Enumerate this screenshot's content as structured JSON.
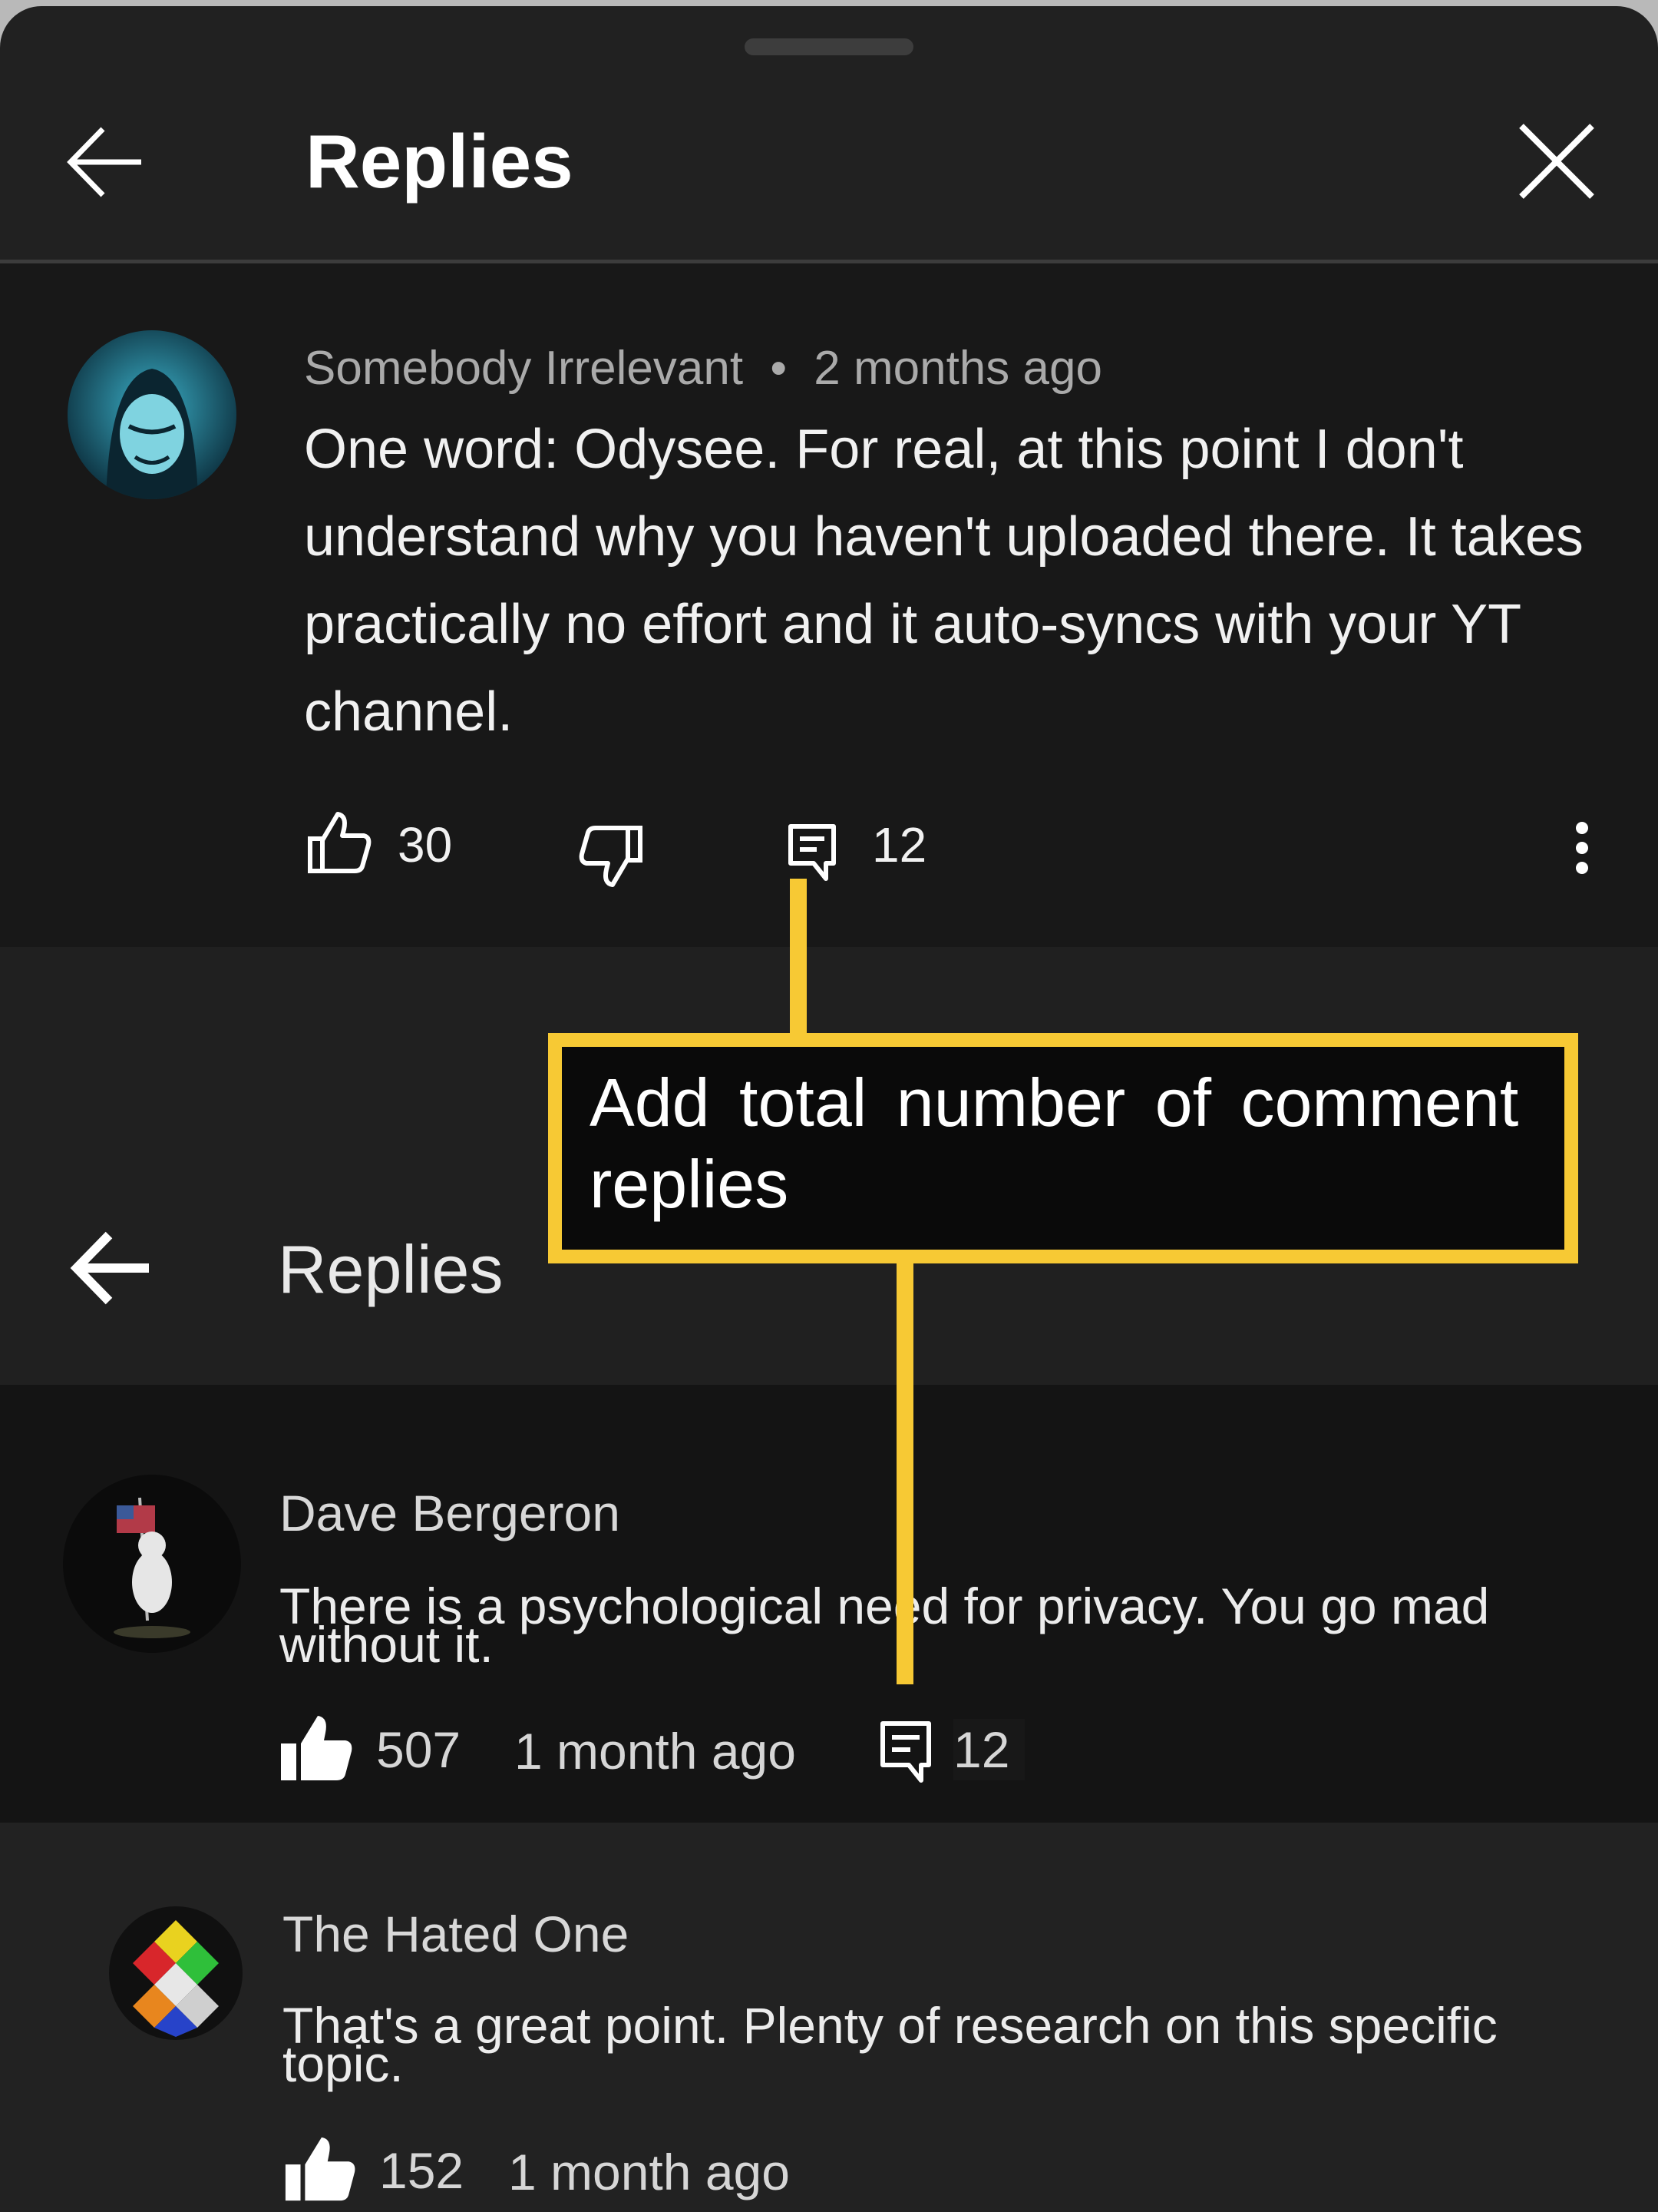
{
  "header": {
    "title": "Replies"
  },
  "top_comment": {
    "author": "Somebody Irrelevant",
    "separator": "•",
    "time": "2 months ago",
    "text": "One word: Odysee. For real, at this point I don't understand why you haven't uploaded there. It takes practically no effort and it auto-syncs with your YT channel.",
    "likes": "30",
    "replies": "12"
  },
  "annotation": {
    "text": "Add total number of comment replies"
  },
  "old_header": {
    "title": "Replies"
  },
  "replies": [
    {
      "author": "Dave Bergeron",
      "text": "There is a psychological need for privacy. You go mad without it.",
      "likes": "507",
      "time": "1 month ago",
      "replies": "12"
    },
    {
      "author": "The Hated One",
      "text": "That's a great point. Plenty of research on this specific topic.",
      "likes": "152",
      "time": "1 month ago"
    }
  ],
  "icons": {
    "back": "arrow-left-icon",
    "close": "close-icon",
    "like": "thumb-up-icon",
    "dislike": "thumb-down-icon",
    "reply": "comment-icon",
    "more": "more-vertical-icon"
  },
  "colors": {
    "accent": "#f7c934",
    "sheet": "#212121",
    "comment_bg": "#181818"
  }
}
